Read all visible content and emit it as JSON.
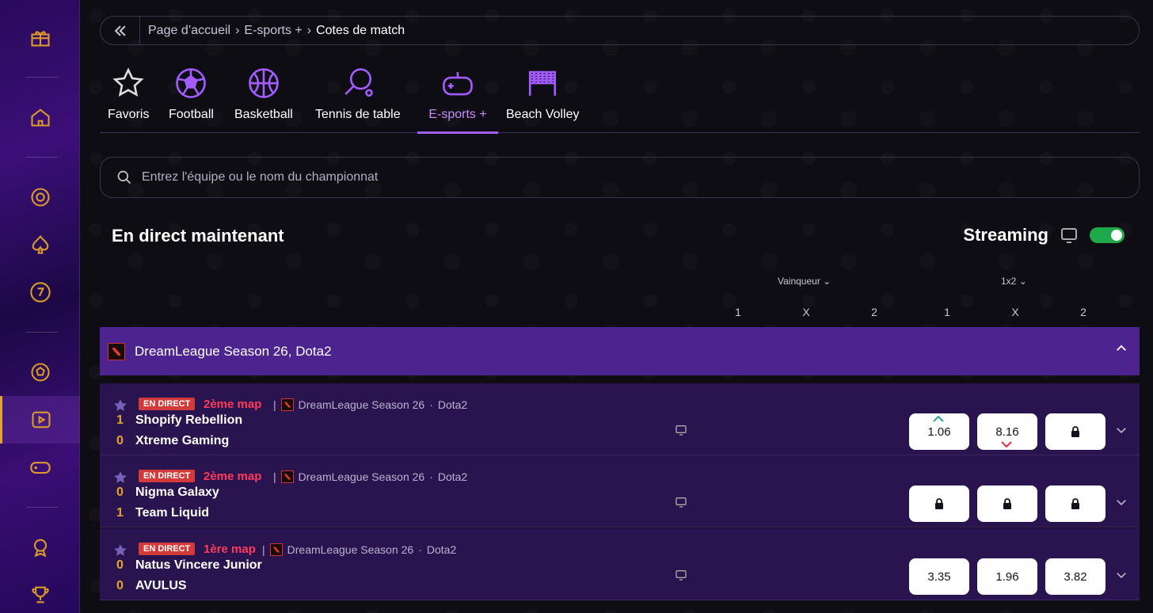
{
  "breadcrumb": {
    "items": [
      "Page d’accueil",
      "E-sports +",
      "Cotes de match"
    ]
  },
  "tabs": [
    {
      "label": "Favoris",
      "icon": "star-icon"
    },
    {
      "label": "Football",
      "icon": "football-icon"
    },
    {
      "label": "Basketball",
      "icon": "basketball-icon"
    },
    {
      "label": "Tennis de table",
      "icon": "table-tennis-icon"
    },
    {
      "label": "E-sports +",
      "icon": "gamepad-icon",
      "active": true
    },
    {
      "label": "Beach Volley",
      "icon": "volleyball-net-icon"
    }
  ],
  "search": {
    "placeholder": "Entrez l'équipe ou le nom du championnat"
  },
  "live": {
    "title": "En direct maintenant",
    "streaming_label": "Streaming",
    "streaming_on": true
  },
  "columns": {
    "group1": "Vainqueur",
    "group2": "1x2",
    "headers": [
      "1",
      "X",
      "2",
      "1",
      "X",
      "2"
    ]
  },
  "league": {
    "name": "DreamLeague Season 26, Dota2"
  },
  "matches": [
    {
      "badge": "EN DIRECT",
      "map": "2ème map",
      "sep": "|",
      "league": "DreamLeague Season 26",
      "dot": "·",
      "game": "Dota2",
      "team1": {
        "score": "1",
        "name": "Shopify Rebellion"
      },
      "team2": {
        "score": "0",
        "name": "Xtreme Gaming"
      },
      "odds": [
        "1.06",
        "8.16",
        "lock"
      ]
    },
    {
      "badge": "EN DIRECT",
      "map": "2ème map",
      "sep": "|",
      "league": "DreamLeague Season 26",
      "dot": "·",
      "game": "Dota2",
      "team1": {
        "score": "0",
        "name": "Nigma Galaxy"
      },
      "team2": {
        "score": "1",
        "name": "Team Liquid"
      },
      "odds": [
        "lock",
        "lock",
        "lock"
      ]
    },
    {
      "badge": "EN DIRECT",
      "map": "1ère map",
      "sep": "|",
      "league": "DreamLeague Season 26",
      "dot": "·",
      "game": "Dota2",
      "team1": {
        "score": "0",
        "name": "Natus Vincere Junior"
      },
      "team2": {
        "score": "0",
        "name": "AVULUS"
      },
      "odds": [
        "3.35",
        "1.96",
        "3.82"
      ]
    }
  ],
  "colors": {
    "accent": "#a35cff",
    "gold": "#e3a530",
    "live": "#ff3b5c",
    "league_bg": "#4d238f"
  }
}
